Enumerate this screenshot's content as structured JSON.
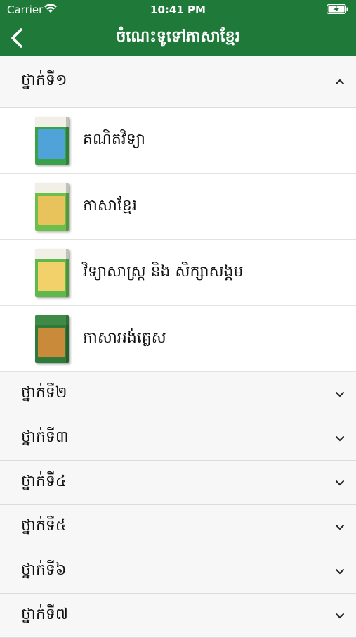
{
  "status_bar": {
    "carrier": "Carrier",
    "time": "10:41 PM"
  },
  "nav": {
    "title": "ចំណេះទូទៅភាសាខ្មែរ"
  },
  "grades": [
    {
      "label": "ថ្នាក់ទី១",
      "expanded": true
    },
    {
      "label": "ថ្នាក់ទី២",
      "expanded": false
    },
    {
      "label": "ថ្នាក់ទី៣",
      "expanded": false
    },
    {
      "label": "ថ្នាក់ទី៤",
      "expanded": false
    },
    {
      "label": "ថ្នាក់ទី៥",
      "expanded": false
    },
    {
      "label": "ថ្នាក់ទី៦",
      "expanded": false
    },
    {
      "label": "ថ្នាក់ទី៧",
      "expanded": false
    }
  ],
  "books": [
    {
      "title": "គណិតវិទ្យា",
      "cover_color": "#3aa04a",
      "art_color": "#4fa3d8"
    },
    {
      "title": "ភាសាខ្មែរ",
      "cover_color": "#6cbf4a",
      "art_color": "#e8c25a"
    },
    {
      "title": "វិទ្យាសាស្ត្រ និង សិក្សាសង្គម",
      "cover_color": "#5fb84a",
      "art_color": "#f2d16a"
    },
    {
      "title": "ភាសាអង់គ្លេស",
      "cover_color": "#2f7a3a",
      "art_color": "#c98a3a"
    }
  ],
  "colors": {
    "header": "#1f7a3a"
  }
}
